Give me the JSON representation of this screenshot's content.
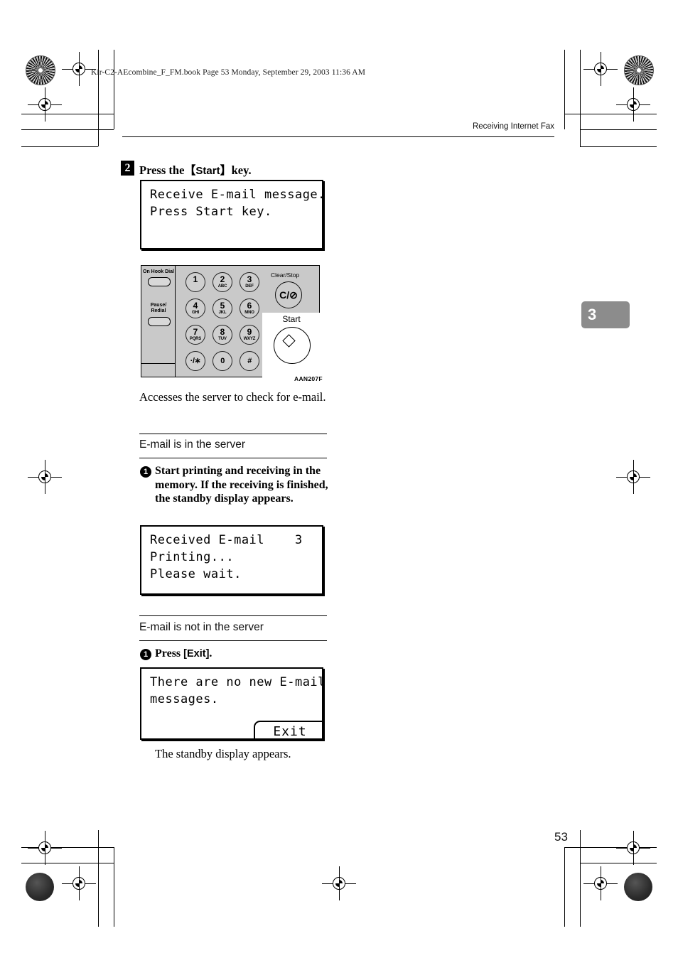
{
  "page": {
    "file_banner": "Kir-C2-AEcombine_F_FM.book  Page 53  Monday, September 29, 2003  11:36 AM",
    "running_head": "Receiving Internet Fax",
    "chapter_tab": "3",
    "page_number": "53"
  },
  "step2": {
    "number": "2",
    "title_before": "Press the",
    "bracket_open": "【",
    "keycap": "Start",
    "bracket_close": "】",
    "title_after": "key.",
    "lcd": {
      "line1": "Receive E-mail message.",
      "line2": "Press Start key."
    },
    "caption": "Accesses the server to check for e-mail."
  },
  "keypad": {
    "figure_code": "AAN207F",
    "side_buttons": [
      {
        "label": "On Hook Dial"
      },
      {
        "label_line1": "Pause/",
        "label_line2": "Redial"
      }
    ],
    "keys": [
      {
        "digit": "1",
        "alpha": ""
      },
      {
        "digit": "2",
        "alpha": "ABC"
      },
      {
        "digit": "3",
        "alpha": "DEF"
      },
      {
        "digit": "4",
        "alpha": "GHI"
      },
      {
        "digit": "5",
        "alpha": "JKL"
      },
      {
        "digit": "6",
        "alpha": "MNO"
      },
      {
        "digit": "7",
        "alpha": "PQRS"
      },
      {
        "digit": "8",
        "alpha": "TUV"
      },
      {
        "digit": "9",
        "alpha": "WXYZ"
      },
      {
        "digit": "·/∗",
        "alpha": ""
      },
      {
        "digit": "0",
        "alpha": ""
      },
      {
        "digit": "#",
        "alpha": ""
      }
    ],
    "clear_stop_label": "Clear/Stop",
    "clear_stop_glyph": "C/⊘",
    "start_label": "Start"
  },
  "section_in_server": {
    "heading": "E-mail is in the server",
    "bullet_number": "1",
    "bullet_text": "Start printing and receiving in the memory. If the receiving is finished, the standby display appears.",
    "lcd": {
      "line1": "Received E-mail    3",
      "line2": "Printing...",
      "line3": "Please wait."
    }
  },
  "section_not_in_server": {
    "heading": "E-mail is not in the server",
    "bullet_number": "1",
    "bullet_text_before": "Press",
    "bullet_bracket_open": "[",
    "bullet_key": "Exit",
    "bullet_bracket_close": "]",
    "bullet_text_after": ".",
    "lcd": {
      "line1": "There are no new E-mail",
      "line2": "messages.",
      "softkey": "Exit"
    },
    "closing_text": "The standby display appears."
  }
}
